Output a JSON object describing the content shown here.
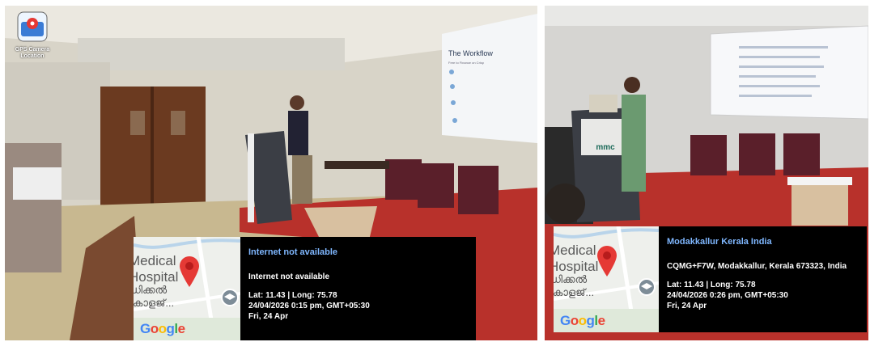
{
  "left_photo": {
    "app_badge": {
      "line1": "GPS Camera",
      "line2": "Location",
      "icon": "map-pin-camera-icon"
    },
    "slide": {
      "title": "The Workflow",
      "subtitle": "Free to Finance on Crisp"
    },
    "map": {
      "place_line1": "Medical",
      "place_line2": "Hospital",
      "place_line3": "ഡിക്കൽ",
      "place_line4": "കോളജ്...",
      "logo": "Google"
    },
    "info": {
      "title": "Internet not available",
      "address": "Internet not available",
      "latlong": "Lat: 11.43 | Long: 75.78",
      "datetime": "24/04/2026  0:15 pm, GMT+05:30",
      "day": "Fri, 24 Apr"
    }
  },
  "right_photo": {
    "podium_logo": "mmc",
    "map": {
      "place_line1": "Medical",
      "place_line2": "Hospital",
      "place_line3": "ഡിക്കൽ",
      "place_line4": "കോളജ്...",
      "logo": "Google"
    },
    "info": {
      "title": "Modakkallur Kerala India",
      "address": "CQMG+F7W, Modakkallur, Kerala 673323, India",
      "latlong": "Lat: 11.43 | Long: 75.78",
      "datetime": "24/04/2026  0:26 pm, GMT+05:30",
      "day": "Fri, 24 Apr"
    }
  },
  "colors": {
    "overlay_bg": "#000000",
    "title_blue": "#7fb7ff",
    "pin_red": "#e53935",
    "floor_red": "#b8312b"
  }
}
